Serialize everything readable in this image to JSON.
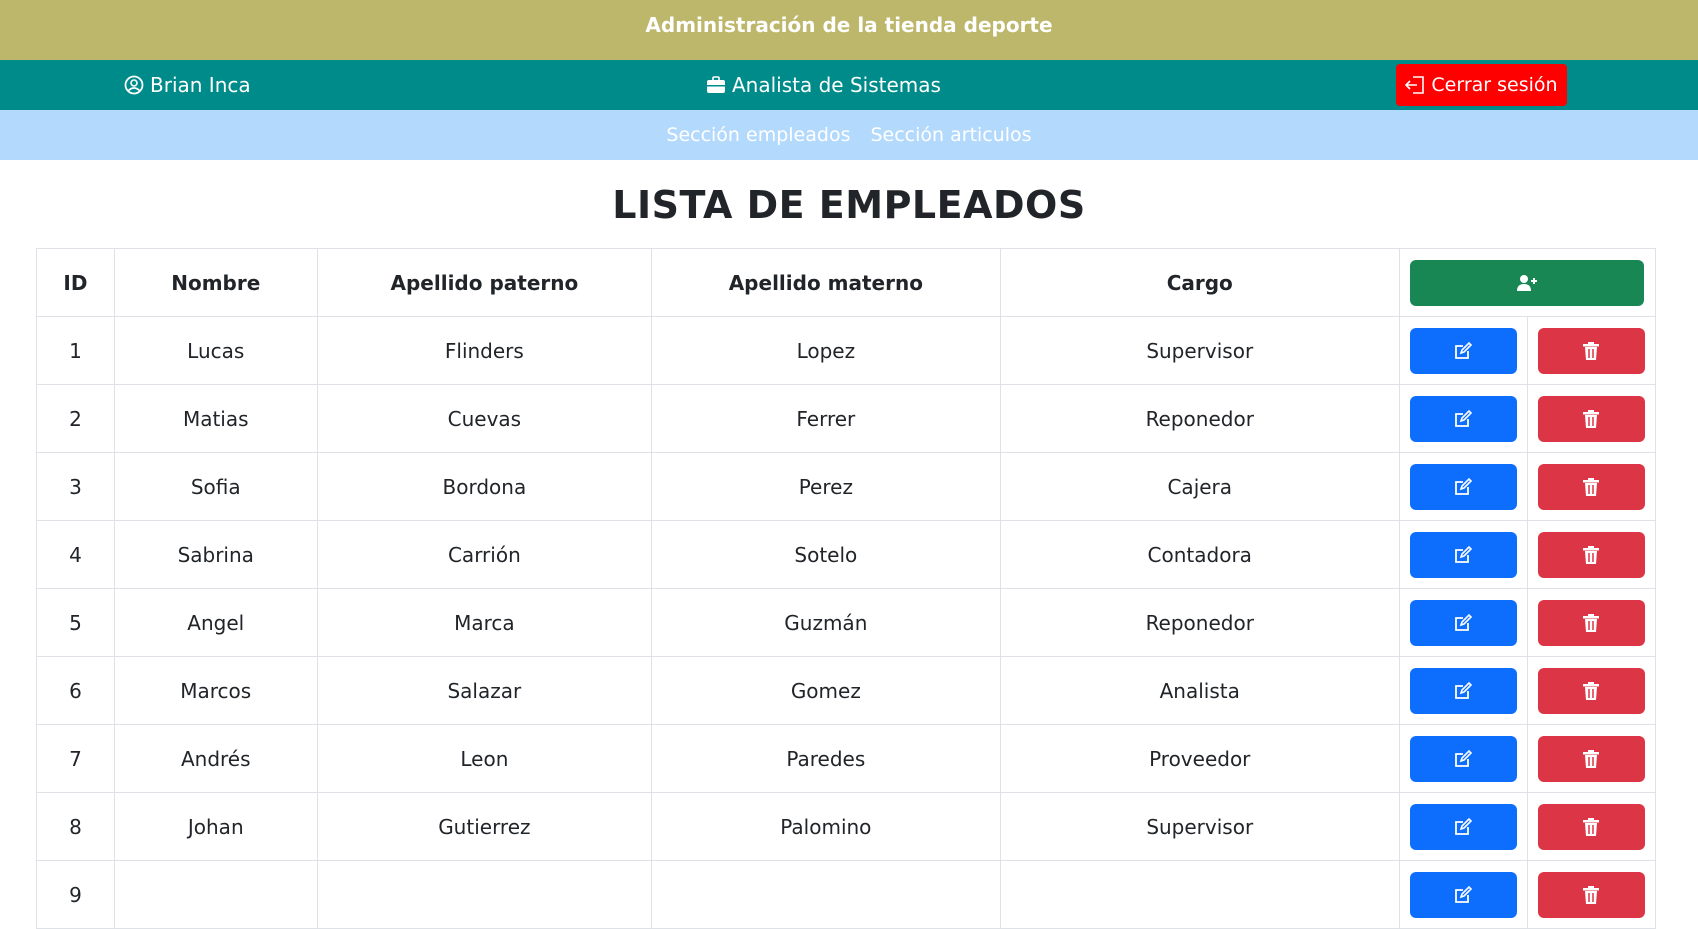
{
  "header": {
    "title": "Administración de la tienda deporte"
  },
  "userbar": {
    "user_name": "Brian Inca",
    "role": "Analista de Sistemas",
    "logout_label": "Cerrar sesión"
  },
  "nav": {
    "items": [
      {
        "label": "Sección empleados"
      },
      {
        "label": "Sección articulos"
      }
    ]
  },
  "page": {
    "heading": "LISTA DE EMPLEADOS"
  },
  "table": {
    "columns": [
      "ID",
      "Nombre",
      "Apellido paterno",
      "Apellido materno",
      "Cargo"
    ],
    "rows": [
      [
        "1",
        "Lucas",
        "Flinders",
        "Lopez",
        "Supervisor"
      ],
      [
        "2",
        "Matias",
        "Cuevas",
        "Ferrer",
        "Reponedor"
      ],
      [
        "3",
        "Sofia",
        "Bordona",
        "Perez",
        "Cajera"
      ],
      [
        "4",
        "Sabrina",
        "Carrión",
        "Sotelo",
        "Contadora"
      ],
      [
        "5",
        "Angel",
        "Marca",
        "Guzmán",
        "Reponedor"
      ],
      [
        "6",
        "Marcos",
        "Salazar",
        "Gomez",
        "Analista"
      ],
      [
        "7",
        "Andrés",
        "Leon",
        "Paredes",
        "Proveedor"
      ],
      [
        "8",
        "Johan",
        "Gutierrez",
        "Palomino",
        "Supervisor"
      ],
      [
        "9",
        "",
        "",
        "",
        ""
      ]
    ]
  },
  "icons": {
    "user": "user-circle-icon",
    "role": "briefcase-icon",
    "logout": "logout-icon",
    "add": "user-plus-icon",
    "edit": "edit-icon",
    "delete": "trash-icon"
  },
  "colors": {
    "topbar": "#bdb76b",
    "userbar": "#008b8b",
    "navbar": "#b3d9fc",
    "logout": "#ff0000",
    "add": "#198754",
    "edit": "#0d6efd",
    "delete": "#dc3545"
  }
}
